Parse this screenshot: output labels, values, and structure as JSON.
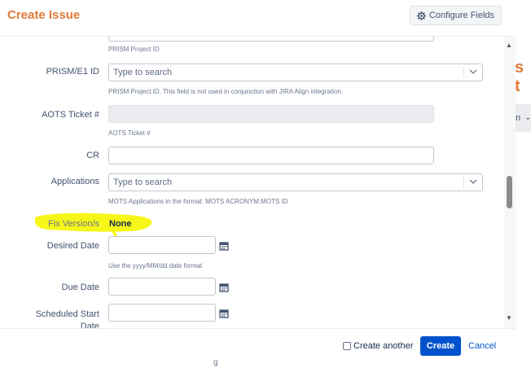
{
  "dialog": {
    "title": "Create Issue",
    "configure_fields_label": "Configure Fields"
  },
  "background": {
    "heading_fragment": "s t",
    "tab_fragment": "n",
    "bottom_fragment": "g"
  },
  "fields": {
    "prism_project_id_desc": "PRISM Project ID",
    "prism_e1": {
      "label": "PRISM/E1 ID",
      "placeholder": "Type to search",
      "desc": "PRISM Project ID. This field is not used in conjunction with JIRA Align integration."
    },
    "aots": {
      "label": "AOTS Ticket #",
      "desc": "AOTS Ticket #"
    },
    "cr": {
      "label": "CR"
    },
    "applications": {
      "label": "Applications",
      "placeholder": "Type to search",
      "desc": "MOTS Applications in the format: MOTS ACRONYM:MOTS ID"
    },
    "fix_version": {
      "label": "Fix Version/s",
      "value": "None"
    },
    "desired_date": {
      "label": "Desired Date",
      "desc": "Use the yyyy/MM/dd date format"
    },
    "due_date": {
      "label": "Due Date"
    },
    "scheduled_start": {
      "label_line1": "Scheduled Start",
      "label_line2": "Date"
    }
  },
  "footer": {
    "create_another_label": "Create another",
    "create_label": "Create",
    "cancel_label": "Cancel"
  },
  "colors": {
    "title": "#e07b39",
    "primary": "#0052cc",
    "highlight": "#f5f500"
  }
}
